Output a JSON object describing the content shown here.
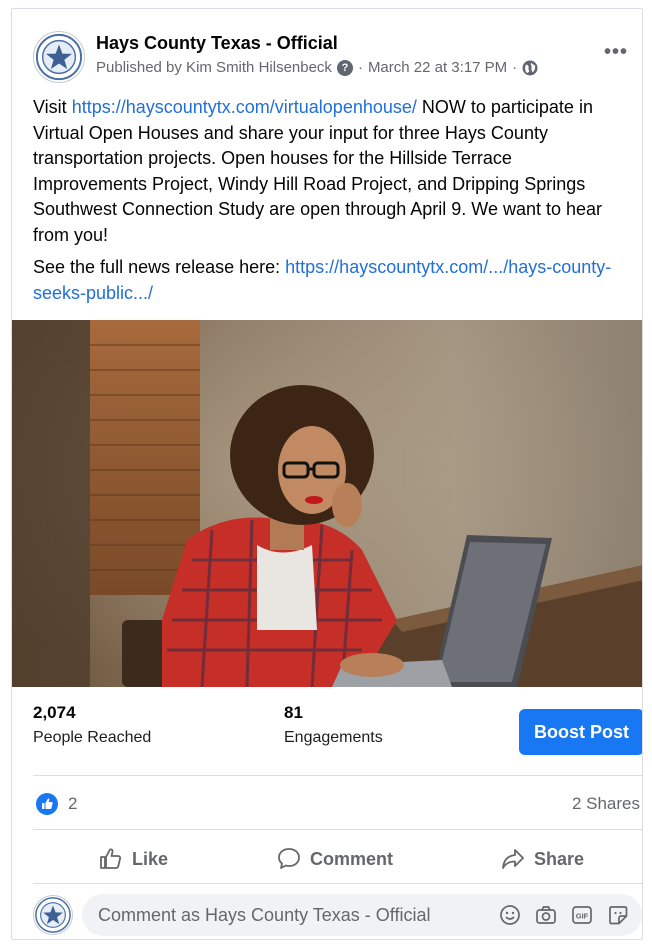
{
  "post": {
    "page_name": "Hays County Texas - Official",
    "published_by": "Published by Kim Smith Hilsenbeck",
    "help_glyph": "?",
    "date": "March 22 at 3:17 PM",
    "separator": "·",
    "audience_icon": "globe-icon",
    "more_icon": "more-options-icon",
    "more_glyph": "•••",
    "text_visit": "Visit ",
    "link_virtual": "https://hayscountytx.com/virtualopenhouse/",
    "text_main": " NOW to participate in Virtual Open Houses and share your input for three Hays County transportation projects. Open houses for the Hillside Terrace Improvements Project, Windy Hill Road Project, and Dripping Springs Southwest Connection Study are open through April 9. We want to hear from you!",
    "text_full_release": "See the full news release here: ",
    "link_release": "https://hayscountytx.com/.../hays-county-seeks-public.../"
  },
  "stats": {
    "people_reached_value": "2,074",
    "people_reached_label": "People Reached",
    "engagements_value": "81",
    "engagements_label": "Engagements",
    "boost_label": "Boost Post"
  },
  "reactions": {
    "like_count": "2",
    "shares": "2 Shares"
  },
  "actions": {
    "like": "Like",
    "comment": "Comment",
    "share": "Share"
  },
  "comment_box": {
    "placeholder": "Comment as Hays County Texas - Official",
    "icons": [
      "emoji-icon",
      "camera-icon",
      "gif-icon",
      "sticker-icon"
    ],
    "gif_text": "GIF"
  },
  "colors": {
    "link": "#216fdb",
    "brand": "#1877f2",
    "secondary_text": "#65676b"
  }
}
